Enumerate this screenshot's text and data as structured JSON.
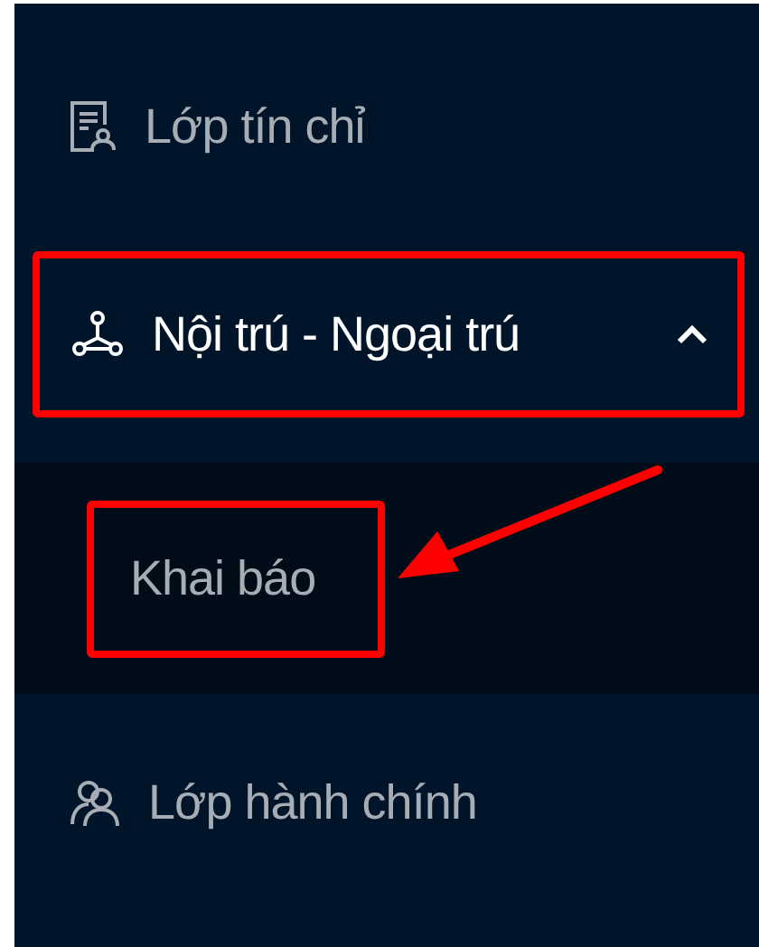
{
  "menu": [
    {
      "kind": "item",
      "label": "Lớp tín chỉ",
      "highlighted": false
    },
    {
      "kind": "submenu",
      "label": "Nội trú - Ngoại trú",
      "expanded": true,
      "highlighted": true,
      "children": [
        {
          "label": "Khai báo",
          "highlighted": true,
          "arrow": true
        }
      ]
    },
    {
      "kind": "item",
      "label": "Lớp hành chính",
      "highlighted": false
    }
  ]
}
